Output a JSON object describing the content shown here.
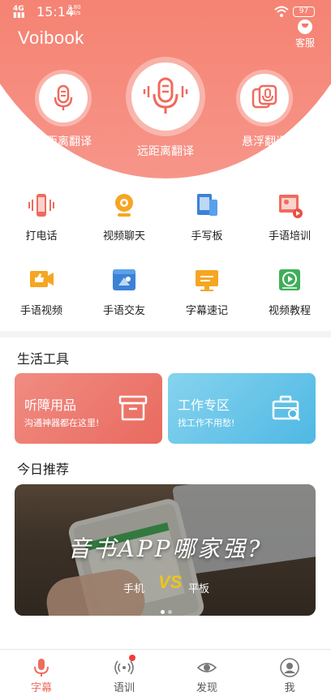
{
  "status_bar": {
    "network": "4G",
    "time": "15:14",
    "speed": "0.80",
    "speed_unit": "KB/s",
    "battery": "97"
  },
  "header": {
    "logo": "Voibook",
    "service_label": "客服"
  },
  "modes": [
    {
      "label": "近距离翻译",
      "icon": "microphone-icon"
    },
    {
      "label": "远距离翻译",
      "icon": "microphone-waves-icon"
    },
    {
      "label": "悬浮翻译",
      "icon": "floating-mic-icon"
    }
  ],
  "features": [
    {
      "label": "打电话",
      "icon": "phone-call-icon"
    },
    {
      "label": "视频聊天",
      "icon": "webcam-icon"
    },
    {
      "label": "手写板",
      "icon": "tablet-pen-icon"
    },
    {
      "label": "手语培训",
      "icon": "sign-training-icon"
    },
    {
      "label": "手语视频",
      "icon": "thumb-video-icon"
    },
    {
      "label": "手语交友",
      "icon": "sign-friends-icon"
    },
    {
      "label": "字幕速记",
      "icon": "subtitle-monitor-icon"
    },
    {
      "label": "视频教程",
      "icon": "play-tutorial-icon"
    }
  ],
  "life_tools": {
    "title": "生活工具",
    "cards": [
      {
        "title": "听障用品",
        "subtitle": "沟通神器都在这里!",
        "color": "#ef7a6f",
        "icon": "archive-box-icon"
      },
      {
        "title": "工作专区",
        "subtitle": "找工作不用愁!",
        "color": "#5fc4e8",
        "icon": "briefcase-search-icon"
      }
    ]
  },
  "today": {
    "title": "今日推荐",
    "banner": {
      "headline": "音书APP哪家强?",
      "label_left": "手机",
      "vs": "VS",
      "label_right": "平板"
    }
  },
  "tabs": [
    {
      "label": "字幕",
      "icon": "mic-tab-icon",
      "active": true
    },
    {
      "label": "语训",
      "icon": "radio-waves-icon",
      "active": false,
      "badge": true
    },
    {
      "label": "发现",
      "icon": "eye-icon",
      "active": false
    },
    {
      "label": "我",
      "icon": "user-avatar-icon",
      "active": false
    }
  ],
  "colors": {
    "brand": "#f2695f",
    "tab_active": "#ef6b5d"
  }
}
